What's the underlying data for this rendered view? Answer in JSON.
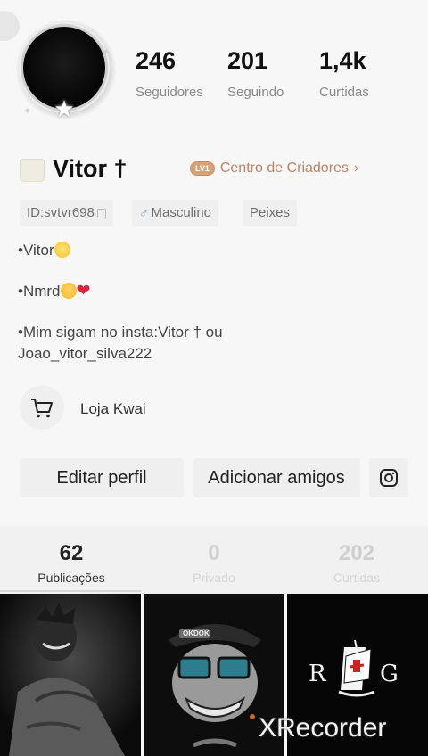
{
  "stats": {
    "followers": {
      "value": "246",
      "label": "Seguidores"
    },
    "following": {
      "value": "201",
      "label": "Seguindo"
    },
    "likes": {
      "value": "1,4k",
      "label": "Curtidas"
    }
  },
  "profile": {
    "name": "Vitor †",
    "creator_level": "LV1",
    "creator_link": "Centro de Criadores",
    "chips": {
      "id": "ID:svtvr698",
      "gender": "Masculino",
      "zodiac": "Peixes"
    }
  },
  "bio": {
    "line1": "•Vitor",
    "line2": "•Nmrd",
    "line3a": "•Mim sigam no insta:Vitor † ou",
    "line3b": "Joao_vitor_silva222"
  },
  "store": {
    "label": "Loja Kwai"
  },
  "buttons": {
    "edit_profile": "Editar perfil",
    "add_friends": "Adicionar amigos"
  },
  "tabs": [
    {
      "count": "62",
      "label": "Publicações"
    },
    {
      "count": "0",
      "label": "Privado"
    },
    {
      "count": "202",
      "label": "Curtidas"
    }
  ],
  "grid": {
    "cell2_cap_text": "OKDOK"
  },
  "watermark": "XRecorder",
  "icons": {
    "cart": "cart-icon",
    "instagram": "instagram-icon",
    "copy": "copy-icon",
    "male": "male-icon",
    "chevron": "chevron-right-icon"
  }
}
